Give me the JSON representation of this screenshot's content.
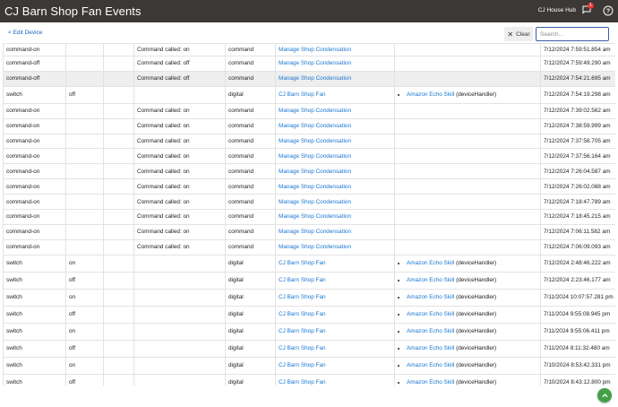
{
  "header": {
    "title": "CJ Barn Shop Fan Events",
    "hub_name": "CJ House Hub",
    "notification_count": "1"
  },
  "toolbar": {
    "edit_device_label": "< Edit Device",
    "clear_label": "Clear",
    "search_placeholder": "Search..."
  },
  "events": [
    {
      "name": "command-on",
      "value": "",
      "unit": "",
      "description": "Command called: on",
      "type": "command",
      "device": "Manage Shop Condensation",
      "triggered_by": "",
      "triggered_detail": "",
      "date": "7/12/2024 7:59:51.854 am"
    },
    {
      "name": "command-off",
      "value": "",
      "unit": "",
      "description": "Command called: off",
      "type": "command",
      "device": "Manage Shop Condensation",
      "triggered_by": "",
      "triggered_detail": "",
      "date": "7/12/2024 7:59:49.290 am"
    },
    {
      "name": "command-off",
      "value": "",
      "unit": "",
      "description": "Command called: off",
      "type": "command",
      "device": "Manage Shop Condensation",
      "triggered_by": "",
      "triggered_detail": "",
      "date": "7/12/2024 7:54:21.695 am"
    },
    {
      "name": "switch",
      "value": "off",
      "unit": "",
      "description": "",
      "type": "digital",
      "device": "CJ Barn Shop Fan",
      "triggered_by": "Amazon Echo Skill",
      "triggered_detail": "(deviceHandler)",
      "date": "7/12/2024 7:54:19.298 am"
    },
    {
      "name": "command-on",
      "value": "",
      "unit": "",
      "description": "Command called: on",
      "type": "command",
      "device": "Manage Shop Condensation",
      "triggered_by": "",
      "triggered_detail": "",
      "date": "7/12/2024 7:39:02.562 am"
    },
    {
      "name": "command-on",
      "value": "",
      "unit": "",
      "description": "Command called: on",
      "type": "command",
      "device": "Manage Shop Condensation",
      "triggered_by": "",
      "triggered_detail": "",
      "date": "7/12/2024 7:38:59.999 am"
    },
    {
      "name": "command-on",
      "value": "",
      "unit": "",
      "description": "Command called: on",
      "type": "command",
      "device": "Manage Shop Condensation",
      "triggered_by": "",
      "triggered_detail": "",
      "date": "7/12/2024 7:37:58.705 am"
    },
    {
      "name": "command-on",
      "value": "",
      "unit": "",
      "description": "Command called: on",
      "type": "command",
      "device": "Manage Shop Condensation",
      "triggered_by": "",
      "triggered_detail": "",
      "date": "7/12/2024 7:37:56.164 am"
    },
    {
      "name": "command-on",
      "value": "",
      "unit": "",
      "description": "Command called: on",
      "type": "command",
      "device": "Manage Shop Condensation",
      "triggered_by": "",
      "triggered_detail": "",
      "date": "7/12/2024 7:26:04.587 am"
    },
    {
      "name": "command-on",
      "value": "",
      "unit": "",
      "description": "Command called: on",
      "type": "command",
      "device": "Manage Shop Condensation",
      "triggered_by": "",
      "triggered_detail": "",
      "date": "7/12/2024 7:26:02.088 am"
    },
    {
      "name": "command-on",
      "value": "",
      "unit": "",
      "description": "Command called: on",
      "type": "command",
      "device": "Manage Shop Condensation",
      "triggered_by": "",
      "triggered_detail": "",
      "date": "7/12/2024 7:18:47.789 am"
    },
    {
      "name": "command-on",
      "value": "",
      "unit": "",
      "description": "Command called: on",
      "type": "command",
      "device": "Manage Shop Condensation",
      "triggered_by": "",
      "triggered_detail": "",
      "date": "7/12/2024 7:18:45.215 am"
    },
    {
      "name": "command-on",
      "value": "",
      "unit": "",
      "description": "Command called: on",
      "type": "command",
      "device": "Manage Shop Condensation",
      "triggered_by": "",
      "triggered_detail": "",
      "date": "7/12/2024 7:06:11.582 am"
    },
    {
      "name": "command-on",
      "value": "",
      "unit": "",
      "description": "Command called: on",
      "type": "command",
      "device": "Manage Shop Condensation",
      "triggered_by": "",
      "triggered_detail": "",
      "date": "7/12/2024 7:06:09.093 am"
    },
    {
      "name": "switch",
      "value": "on",
      "unit": "",
      "description": "",
      "type": "digital",
      "device": "CJ Barn Shop Fan",
      "triggered_by": "Amazon Echo Skill",
      "triggered_detail": "(deviceHandler)",
      "date": "7/12/2024 2:48:46.222 am"
    },
    {
      "name": "switch",
      "value": "off",
      "unit": "",
      "description": "",
      "type": "digital",
      "device": "CJ Barn Shop Fan",
      "triggered_by": "Amazon Echo Skill",
      "triggered_detail": "(deviceHandler)",
      "date": "7/12/2024 2:23:46.177 am"
    },
    {
      "name": "switch",
      "value": "on",
      "unit": "",
      "description": "",
      "type": "digital",
      "device": "CJ Barn Shop Fan",
      "triggered_by": "Amazon Echo Skill",
      "triggered_detail": "(deviceHandler)",
      "date": "7/11/2024 10:07:57.281 pm"
    },
    {
      "name": "switch",
      "value": "off",
      "unit": "",
      "description": "",
      "type": "digital",
      "device": "CJ Barn Shop Fan",
      "triggered_by": "Amazon Echo Skill",
      "triggered_detail": "(deviceHandler)",
      "date": "7/11/2024 9:55:08.945 pm"
    },
    {
      "name": "switch",
      "value": "on",
      "unit": "",
      "description": "",
      "type": "digital",
      "device": "CJ Barn Shop Fan",
      "triggered_by": "Amazon Echo Skill",
      "triggered_detail": "(deviceHandler)",
      "date": "7/11/2024 9:55:06.411 pm"
    },
    {
      "name": "switch",
      "value": "off",
      "unit": "",
      "description": "",
      "type": "digital",
      "device": "CJ Barn Shop Fan",
      "triggered_by": "Amazon Echo Skill",
      "triggered_detail": "(deviceHandler)",
      "date": "7/11/2024 8:11:32.480 am"
    },
    {
      "name": "switch",
      "value": "on",
      "unit": "",
      "description": "",
      "type": "digital",
      "device": "CJ Barn Shop Fan",
      "triggered_by": "Amazon Echo Skill",
      "triggered_detail": "(deviceHandler)",
      "date": "7/10/2024 8:53:42.331 pm"
    },
    {
      "name": "switch",
      "value": "off",
      "unit": "",
      "description": "",
      "type": "digital",
      "device": "CJ Barn Shop Fan",
      "triggered_by": "Amazon Echo Skill",
      "triggered_detail": "(deviceHandler)",
      "date": "7/10/2024 8:43:12.800 pm"
    }
  ],
  "highlighted_row": 2,
  "colors": {
    "topbar": "#3c3836",
    "link": "#1976d2",
    "fab": "#43a047",
    "badge": "#e53935"
  }
}
